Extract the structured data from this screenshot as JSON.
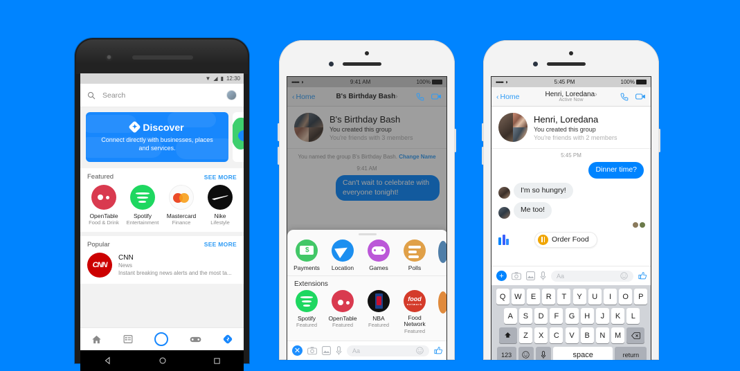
{
  "background_color": "#0084ff",
  "accent_blue": "#0084ff",
  "android": {
    "status": {
      "time": "12:30",
      "icons": [
        "wifi-down-icon",
        "signal-icon",
        "battery-icon"
      ]
    },
    "search": {
      "placeholder": "Search",
      "icon": "search-icon",
      "avatar": "profile-avatar"
    },
    "discover_card": {
      "title": "Discover",
      "subtitle": "Connect directly with businesses, places and services.",
      "badge_icon": "discover-bolt-icon"
    },
    "featured": {
      "title": "Featured",
      "see_more": "SEE MORE",
      "apps": [
        {
          "name": "OpenTable",
          "category": "Food & Drink",
          "icon": "opentable-logo"
        },
        {
          "name": "Spotify",
          "category": "Entertainment",
          "icon": "spotify-logo"
        },
        {
          "name": "Mastercard",
          "category": "Finance",
          "icon": "mastercard-logo"
        },
        {
          "name": "Nike",
          "category": "Lifestyle",
          "icon": "nike-logo"
        }
      ]
    },
    "popular": {
      "title": "Popular",
      "see_more": "SEE MORE",
      "item": {
        "name": "CNN",
        "category": "News",
        "description": "Instant breaking news alerts and the most ta...",
        "icon": "cnn-logo"
      }
    },
    "tabs": [
      {
        "name": "home",
        "icon": "home-icon",
        "active": false
      },
      {
        "name": "messages",
        "icon": "list-icon",
        "active": false
      },
      {
        "name": "camera",
        "icon": "camera-circle-icon",
        "active": true
      },
      {
        "name": "games",
        "icon": "gamepad-icon",
        "active": false
      },
      {
        "name": "discover",
        "icon": "discover-bolt-icon",
        "active": false
      }
    ],
    "system_nav": [
      "back-triangle-icon",
      "home-circle-icon",
      "recents-square-icon"
    ]
  },
  "iphone_middle": {
    "status": {
      "signal": "•••••",
      "wifi": "wifi-icon",
      "time": "9:41 AM",
      "battery": "100%"
    },
    "nav": {
      "back": "Home",
      "title": "B's Birthday Bash",
      "chevron": "›",
      "call_icon": "phone-icon",
      "video_icon": "video-camera-icon"
    },
    "thread": {
      "name": "B's Birthday Bash",
      "line1": "You created this group",
      "line2": "You're friends with 3 members"
    },
    "system_message": "You named the group B's Birthday Bash.",
    "change_name_link": "Change Name",
    "timestamp": "9:41 AM",
    "outgoing_message": "Can't wait to celebrate with everyone tonight!",
    "sheet": {
      "tray": [
        {
          "name": "Payments",
          "icon": "payments-icon"
        },
        {
          "name": "Location",
          "icon": "location-arrow-icon"
        },
        {
          "name": "Games",
          "icon": "games-controller-icon"
        },
        {
          "name": "Polls",
          "icon": "polls-icon"
        }
      ],
      "extensions_header": "Extensions",
      "extensions": [
        {
          "name": "Spotify",
          "label": "Featured",
          "icon": "spotify-logo"
        },
        {
          "name": "OpenTable",
          "label": "Featured",
          "icon": "opentable-logo"
        },
        {
          "name": "NBA",
          "label": "Featured",
          "icon": "nba-logo"
        },
        {
          "name": "Food Network",
          "label": "Featured",
          "icon": "food-network-logo"
        }
      ]
    },
    "composer": {
      "close_icon": "close-x-icon",
      "camera_icon": "camera-icon",
      "photos_icon": "photos-icon",
      "mic_icon": "microphone-icon",
      "input_placeholder": "Aa",
      "emoji_icon": "smiley-icon",
      "like_icon": "thumbs-up-icon"
    }
  },
  "iphone_right": {
    "status": {
      "signal": "•••••",
      "wifi": "wifi-icon",
      "time": "5:45 PM",
      "battery": "100%"
    },
    "nav": {
      "back": "Home",
      "title": "Henri, Loredana",
      "chevron": "›",
      "subtitle": "Active Now",
      "call_icon": "phone-icon",
      "video_icon": "video-camera-icon"
    },
    "thread": {
      "name": "Henri, Loredana",
      "line1": "You created this group",
      "line2": "You're friends with 2 members"
    },
    "timestamp": "5:45 PM",
    "messages": [
      {
        "direction": "out",
        "text": "Dinner time?"
      },
      {
        "direction": "in",
        "text": "I'm so hungry!",
        "avatar": "henri-avatar"
      },
      {
        "direction": "in",
        "text": "Me too!",
        "avatar": "loredana-avatar"
      }
    ],
    "order_food": {
      "label": "Order Food",
      "icon": "utensils-icon",
      "logo": "messenger-m-logo"
    },
    "composer": {
      "plus_icon": "plus-icon",
      "camera_icon": "camera-icon",
      "photos_icon": "photos-icon",
      "mic_icon": "microphone-icon",
      "input_placeholder": "Aa",
      "emoji_icon": "smiley-icon",
      "like_icon": "thumbs-up-icon"
    },
    "keyboard": {
      "row1": [
        "Q",
        "W",
        "E",
        "R",
        "T",
        "Y",
        "U",
        "I",
        "O",
        "P"
      ],
      "row2": [
        "A",
        "S",
        "D",
        "F",
        "G",
        "H",
        "J",
        "K",
        "L"
      ],
      "row3": [
        "Z",
        "X",
        "C",
        "V",
        "B",
        "N",
        "M"
      ],
      "shift": "shift-icon",
      "backspace": "backspace-icon",
      "numbers": "123",
      "emoji": "smiley-icon",
      "dictation": "microphone-icon",
      "space": "space",
      "return": "return"
    }
  }
}
